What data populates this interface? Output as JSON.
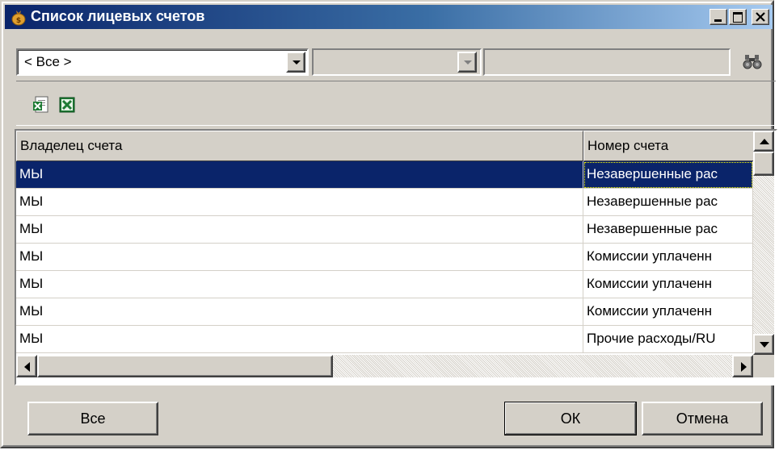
{
  "window": {
    "title": "Список лицевых счетов",
    "icon": "money-bag-icon"
  },
  "filter": {
    "combo1_value": "< Все >",
    "combo2_value": "",
    "search_value": ""
  },
  "toolbar": {
    "export_icon_1": "excel-export-icon",
    "export_icon_2": "excel-icon"
  },
  "grid": {
    "columns": [
      "Владелец счета",
      "Номер счета"
    ],
    "rows": [
      {
        "owner": "МЫ",
        "number": "Незавершенные рас"
      },
      {
        "owner": "МЫ",
        "number": "Незавершенные рас"
      },
      {
        "owner": "МЫ",
        "number": "Незавершенные рас"
      },
      {
        "owner": "МЫ",
        "number": "Комиссии уплаченн"
      },
      {
        "owner": "МЫ",
        "number": "Комиссии уплаченн"
      },
      {
        "owner": "МЫ",
        "number": "Комиссии уплаченн"
      },
      {
        "owner": "МЫ",
        "number": "Прочие расходы/RU"
      }
    ],
    "selected_row": 0
  },
  "buttons": {
    "all": "Все",
    "ok": "ОК",
    "cancel": "Отмена"
  }
}
